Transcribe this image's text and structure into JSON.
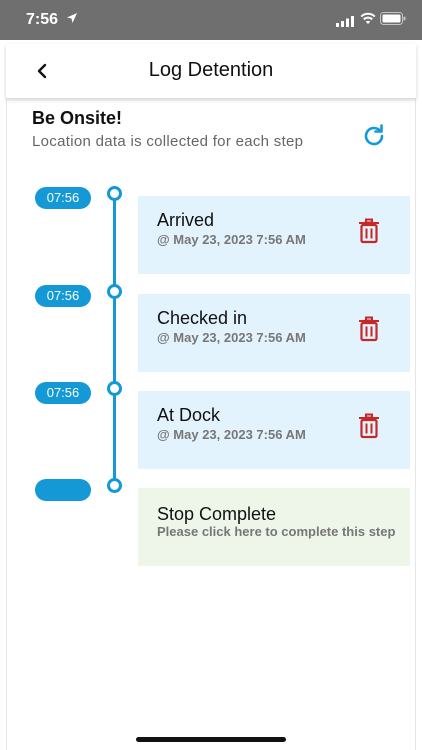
{
  "status_bar": {
    "time": "7:56"
  },
  "header": {
    "title": "Log Detention"
  },
  "section": {
    "title": "Be Onsite!",
    "subtitle": "Location data is collected for each step"
  },
  "steps": [
    {
      "time": "07:56",
      "title": "Arrived",
      "subtitle": "@ May 23, 2023 7:56 AM",
      "status": "done"
    },
    {
      "time": "07:56",
      "title": "Checked in",
      "subtitle": "@ May 23, 2023 7:56 AM",
      "status": "done"
    },
    {
      "time": "07:56",
      "title": "At Dock",
      "subtitle": "@ May 23, 2023 7:56 AM",
      "status": "done"
    },
    {
      "time": "",
      "title": "Stop Complete",
      "subtitle": "Please click here to complete this step",
      "status": "pending"
    }
  ],
  "colors": {
    "accent": "#1499d6",
    "done_card": "#e3f3fd",
    "pending_card": "#eef6ea",
    "delete": "#c62828"
  }
}
